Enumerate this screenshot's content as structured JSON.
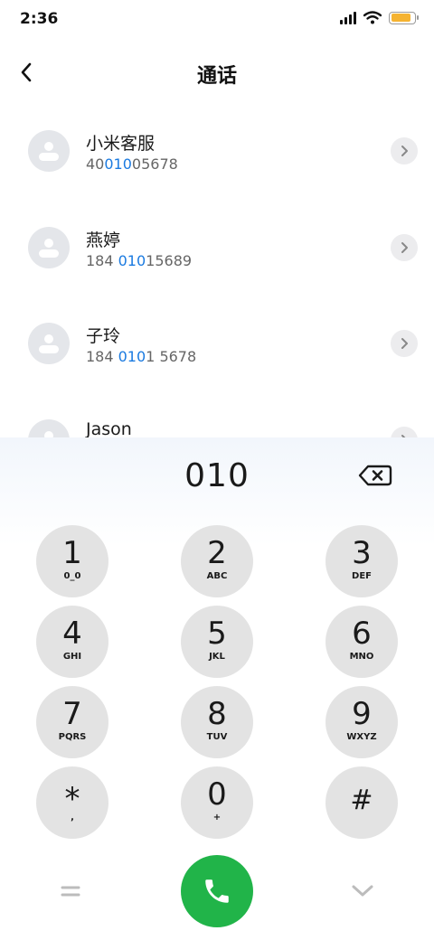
{
  "status": {
    "time": "2:36",
    "battery_level": 0.85
  },
  "header": {
    "title": "通话",
    "back_icon": "chevron-left-icon"
  },
  "contacts": [
    {
      "name": "小米客服",
      "number_pre": "40",
      "number_match": "010",
      "number_post": "05678"
    },
    {
      "name": "燕婷",
      "number_pre": "184 ",
      "number_match": "010",
      "number_post": "15689"
    },
    {
      "name": "子玲",
      "number_pre": "184 ",
      "number_match": "010",
      "number_post": "1 5678"
    },
    {
      "name": "Jason",
      "number_pre": "",
      "number_match": "",
      "number_post": ""
    }
  ],
  "dialer": {
    "input": "010",
    "keys": [
      {
        "digit": "1",
        "letters": "0_0"
      },
      {
        "digit": "2",
        "letters": "ABC"
      },
      {
        "digit": "3",
        "letters": "DEF"
      },
      {
        "digit": "4",
        "letters": "GHI"
      },
      {
        "digit": "5",
        "letters": "JKL"
      },
      {
        "digit": "6",
        "letters": "MNO"
      },
      {
        "digit": "7",
        "letters": "PQRS"
      },
      {
        "digit": "8",
        "letters": "TUV"
      },
      {
        "digit": "9",
        "letters": "WXYZ"
      },
      {
        "digit": "*",
        "letters": ","
      },
      {
        "digit": "0",
        "letters": "+"
      },
      {
        "digit": "#",
        "letters": ""
      }
    ]
  },
  "colors": {
    "highlight": "#1a7ae0",
    "call_button": "#21b449",
    "key_background": "#e3e3e3"
  },
  "icons": {
    "backspace": "backspace-icon",
    "menu": "menu-icon",
    "call": "phone-icon",
    "collapse": "chevron-down-icon"
  }
}
